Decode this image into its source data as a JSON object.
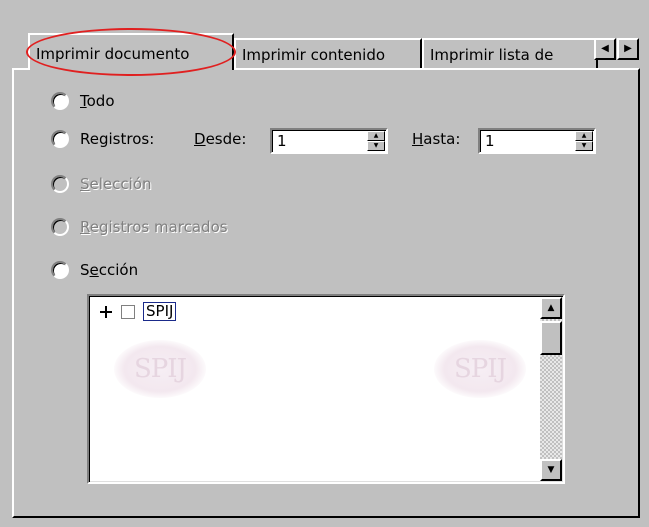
{
  "tabs": [
    {
      "label": "Imprimir documento"
    },
    {
      "label": "Imprimir contenido"
    },
    {
      "label": "Imprimir lista de"
    }
  ],
  "tab_scroll": {
    "left_icon": "arrow-left-icon",
    "right_icon": "arrow-right-icon"
  },
  "options": {
    "todo": {
      "first": "T",
      "rest": "odo"
    },
    "registros": {
      "label": "Registros:"
    },
    "desde": {
      "first": "D",
      "rest": "esde:",
      "value": "1"
    },
    "hasta": {
      "first": "H",
      "rest": "asta:",
      "value": "1"
    },
    "seleccion": {
      "first": "S",
      "rest": "elección"
    },
    "marcados": {
      "first": "R",
      "rest": "egistros marcados"
    },
    "seccion": {
      "before": "S",
      "underlined": "e",
      "after": "cción"
    }
  },
  "tree": {
    "node_label": "SPIJ",
    "watermark_text": "SPIJ"
  },
  "colors": {
    "highlight_circle": "#e02020",
    "dialog_bg": "#c0c0c0"
  }
}
